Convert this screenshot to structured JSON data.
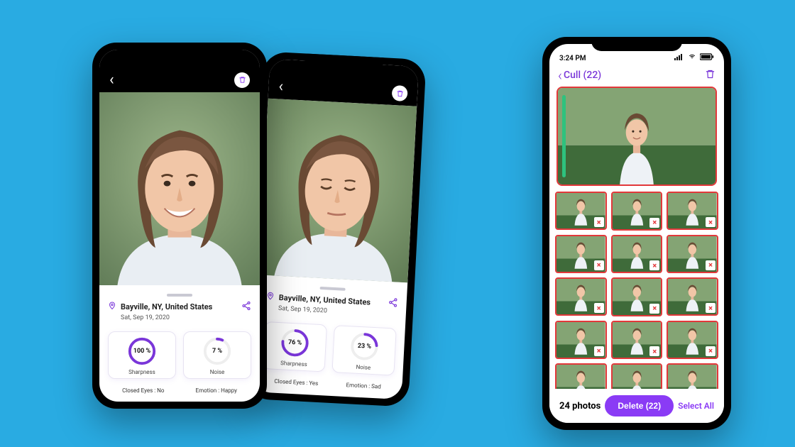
{
  "colors": {
    "accent": "#8a3bf5",
    "danger": "#e2383a",
    "bg": "#29abe2"
  },
  "phone1": {
    "location": "Bayville, NY, United States",
    "date": "Sat, Sep 19, 2020",
    "sharpness": {
      "percent": 100,
      "display": "100 %",
      "label": "Sharpness"
    },
    "noise": {
      "percent": 7,
      "display": "7 %",
      "label": "Noise"
    },
    "closed_eyes": "Closed Eyes : No",
    "emotion": "Emotion : Happy"
  },
  "phone2": {
    "location": "Bayville, NY, United States",
    "date": "Sat, Sep 19, 2020",
    "sharpness": {
      "percent": 76,
      "display": "76 %",
      "label": "Sharpness"
    },
    "noise": {
      "percent": 23,
      "display": "23 %",
      "label": "Noise"
    },
    "closed_eyes": "Closed Eyes : Yes",
    "emotion": "Emotion : Sad"
  },
  "phone3": {
    "time": "3:24 PM",
    "header_back": "Cull (22)",
    "photo_count": "24 photos",
    "delete_label": "Delete (22)",
    "select_all": "Select All",
    "thumbs": 15,
    "mark": "×"
  }
}
